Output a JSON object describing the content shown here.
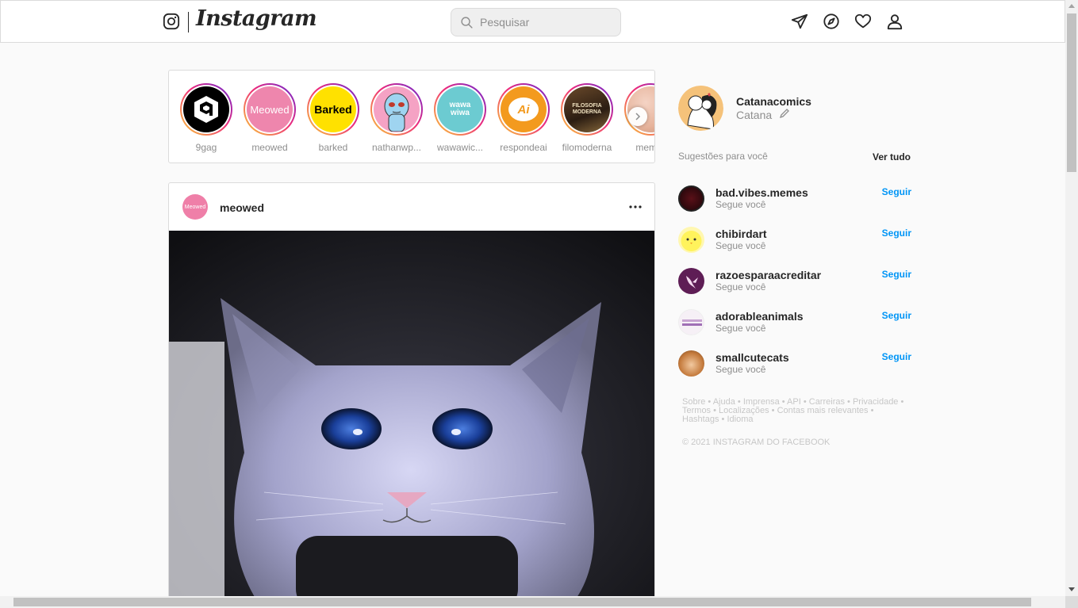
{
  "header": {
    "logo_text": "Instagram",
    "search_placeholder": "Pesquisar",
    "icons": [
      "instagram-glyph-icon",
      "search-icon",
      "direct-send-icon",
      "explore-compass-icon",
      "activity-heart-icon",
      "profile-icon"
    ]
  },
  "stories": {
    "items": [
      {
        "username": "9gag",
        "label": "9"
      },
      {
        "username": "meowed",
        "label": "Meowed"
      },
      {
        "username": "barked",
        "label": "Barked"
      },
      {
        "username": "nathanwp...",
        "label": ""
      },
      {
        "username": "wawawic...",
        "label": "wawa wiwa"
      },
      {
        "username": "respondeai",
        "label": "Ai"
      },
      {
        "username": "filomoderna",
        "label": "FILOSOFIA MODERNA"
      },
      {
        "username": "memer",
        "label": ""
      }
    ]
  },
  "post": {
    "username": "meowed",
    "avatar_label": "Meowed"
  },
  "sidebar": {
    "me": {
      "username": "Catanacomics",
      "fullname": "Catana"
    },
    "suggestions_title": "Sugestões para você",
    "see_all": "Ver tudo",
    "suggestions": [
      {
        "username": "bad.vibes.memes",
        "sub": "Segue você",
        "action": "Seguir"
      },
      {
        "username": "chibirdart",
        "sub": "Segue você",
        "action": "Seguir"
      },
      {
        "username": "razoesparaacreditar",
        "sub": "Segue você",
        "action": "Seguir"
      },
      {
        "username": "adorableanimals",
        "sub": "Segue você",
        "action": "Seguir"
      },
      {
        "username": "smallcutecats",
        "sub": "Segue você",
        "action": "Seguir"
      }
    ],
    "footer_links": [
      "Sobre",
      "Ajuda",
      "Imprensa",
      "API",
      "Carreiras",
      "Privacidade",
      "Termos",
      "Localizações",
      "Contas mais relevantes",
      "Hashtags",
      "Idioma"
    ],
    "copyright": "© 2021 INSTAGRAM DO FACEBOOK"
  },
  "colors": {
    "link_blue": "#0095f6",
    "border": "#dbdbdb",
    "muted_text": "#8e8e8e",
    "story_ring_start": "#f9ce34",
    "story_ring_end": "#6228d7"
  }
}
